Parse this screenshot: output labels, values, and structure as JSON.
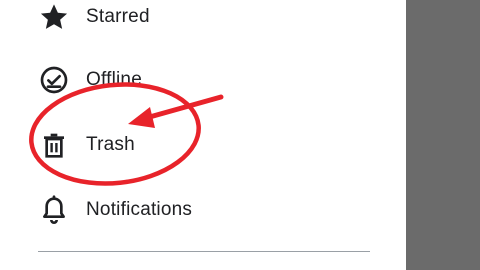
{
  "drawer": {
    "items": [
      {
        "label": "Starred",
        "icon": "star-icon"
      },
      {
        "label": "Offline",
        "icon": "offline-check-icon"
      },
      {
        "label": "Trash",
        "icon": "trash-icon"
      },
      {
        "label": "Notifications",
        "icon": "bell-icon"
      }
    ]
  },
  "annotation": {
    "color": "#e8232a",
    "shape": "ellipse-with-arrow",
    "highlighted_item": "Trash"
  },
  "colors": {
    "drawer_bg": "#ffffff",
    "scrim": "#6b6b6b",
    "text": "#202124",
    "icon": "#202124",
    "divider": "#9aa0a6"
  }
}
